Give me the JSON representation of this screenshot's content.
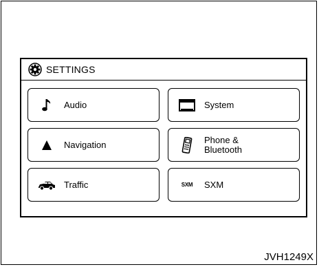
{
  "screen": {
    "title": "SETTINGS",
    "title_icon": "gear-icon"
  },
  "buttons": [
    {
      "label": "Audio",
      "icon": "music-note-icon"
    },
    {
      "label": "System",
      "icon": "monitor-icon"
    },
    {
      "label": "Navigation",
      "icon": "navigation-arrow-icon"
    },
    {
      "label": "Phone &\nBluetooth",
      "icon": "phone-icon"
    },
    {
      "label": "Traffic",
      "icon": "traffic-cars-icon"
    },
    {
      "label": "SXM",
      "icon": "sxm-icon"
    }
  ],
  "sxm_icon_text": "SXM",
  "figure_id": "JVH1249X"
}
